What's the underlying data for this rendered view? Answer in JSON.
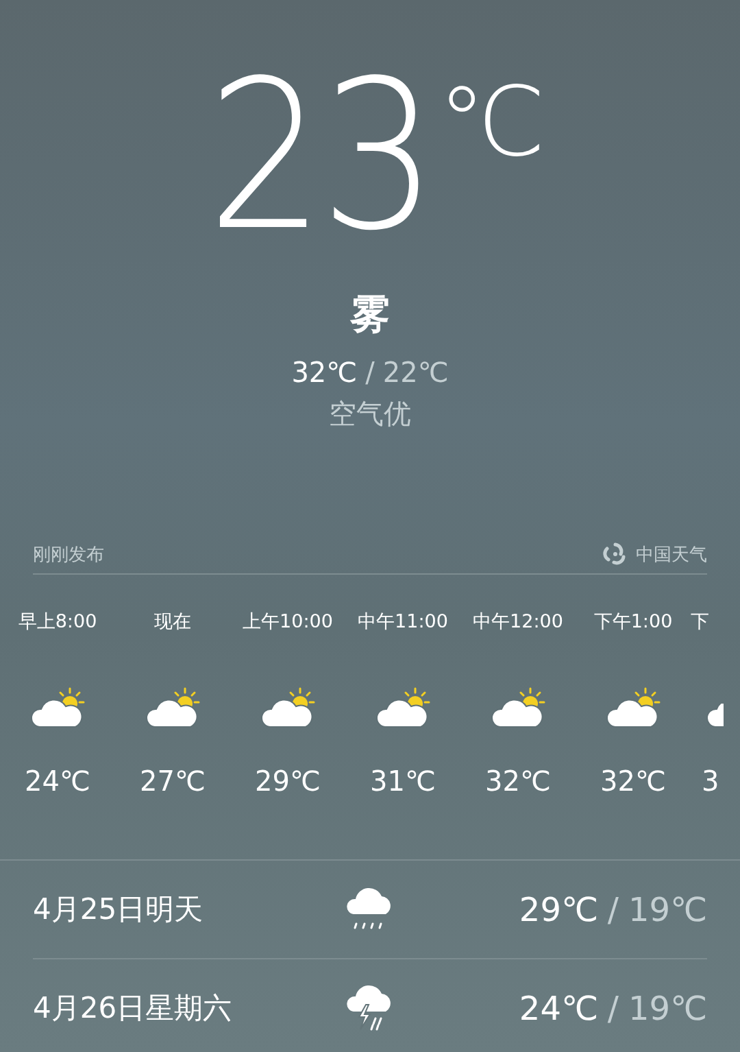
{
  "current": {
    "temperature": "23",
    "unit": "℃",
    "condition": "雾",
    "high": "32℃",
    "separator": "/",
    "low": "22℃",
    "air_quality": "空气优"
  },
  "source_bar": {
    "published": "刚刚发布",
    "provider": "中国天气"
  },
  "hourly": [
    {
      "time": "早上8:00",
      "kind": "partly-cloudy",
      "temp": "24℃"
    },
    {
      "time": "现在",
      "kind": "partly-cloudy",
      "temp": "27℃"
    },
    {
      "time": "上午10:00",
      "kind": "partly-cloudy",
      "temp": "29℃"
    },
    {
      "time": "中午11:00",
      "kind": "partly-cloudy",
      "temp": "31℃"
    },
    {
      "time": "中午12:00",
      "kind": "partly-cloudy",
      "temp": "32℃"
    },
    {
      "time": "下午1:00",
      "kind": "partly-cloudy",
      "temp": "32℃"
    },
    {
      "time": "下",
      "kind": "partly-cloudy",
      "temp": "3"
    }
  ],
  "daily": [
    {
      "date": "4月25日明天",
      "kind": "rain",
      "high": "29℃",
      "separator": "/",
      "low": "19℃"
    },
    {
      "date": "4月26日星期六",
      "kind": "thunderstorm",
      "high": "24℃",
      "separator": "/",
      "low": "19℃"
    }
  ]
}
